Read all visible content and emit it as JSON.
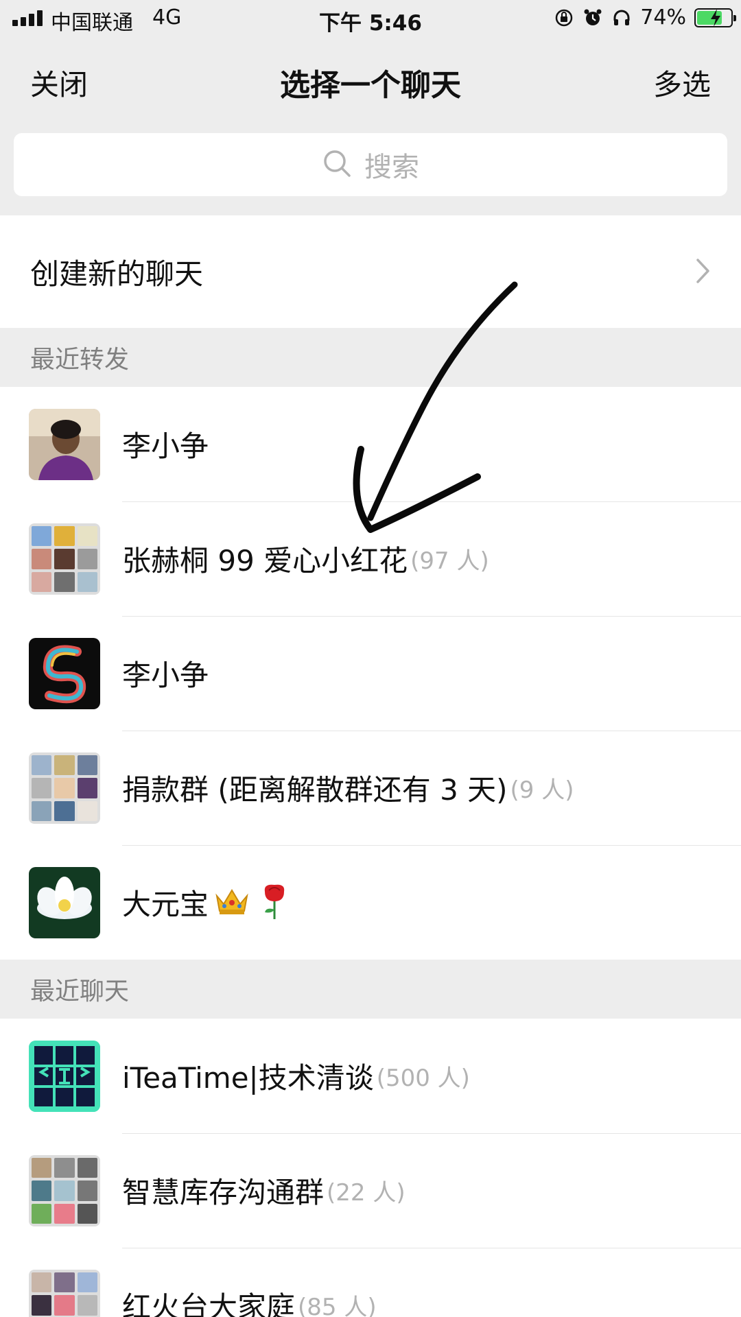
{
  "status_bar": {
    "carrier": "中国联通",
    "network": "4G",
    "time": "下午 5:46",
    "battery_percent": "74%",
    "battery_level": 0.74,
    "icons": [
      "signal-icon",
      "orientation-lock-icon",
      "alarm-icon",
      "headphones-icon",
      "battery-icon"
    ]
  },
  "nav": {
    "close_label": "关闭",
    "title": "选择一个聊天",
    "multi_select_label": "多选"
  },
  "search": {
    "placeholder": "搜索"
  },
  "create_chat": {
    "label": "创建新的聊天"
  },
  "sections": {
    "recent_forward_title": "最近转发",
    "recent_chats_title": "最近聊天"
  },
  "recent_forwards": [
    {
      "name": "李小争",
      "count": "",
      "avatar": "person-photo"
    },
    {
      "name": "张赫桐 99 爱心小红花",
      "count": "(97 人)",
      "avatar": "group-grid"
    },
    {
      "name": "李小争",
      "count": "",
      "avatar": "rainbow-swirl"
    },
    {
      "name": "捐款群 (距离解散群还有 3 天)",
      "count": "(9 人)",
      "avatar": "group-grid"
    },
    {
      "name": "大元宝",
      "count": "",
      "avatar": "lotus-flower",
      "emojis": [
        "crown-emoji",
        "rose-emoji"
      ]
    }
  ],
  "recent_chats": [
    {
      "name": "iTeaTime|技术清谈",
      "count": "(500 人)",
      "avatar": "iteatime-logo"
    },
    {
      "name": "智慧库存沟通群",
      "count": "(22 人)",
      "avatar": "group-grid"
    },
    {
      "name": "红火台大家庭",
      "count": "(85 人)",
      "avatar": "group-grid"
    }
  ],
  "colors": {
    "background": "#ededed",
    "panel": "#ffffff",
    "section_text": "#808080",
    "muted_text": "#b2b2b2",
    "battery_green": "#4cd964"
  }
}
